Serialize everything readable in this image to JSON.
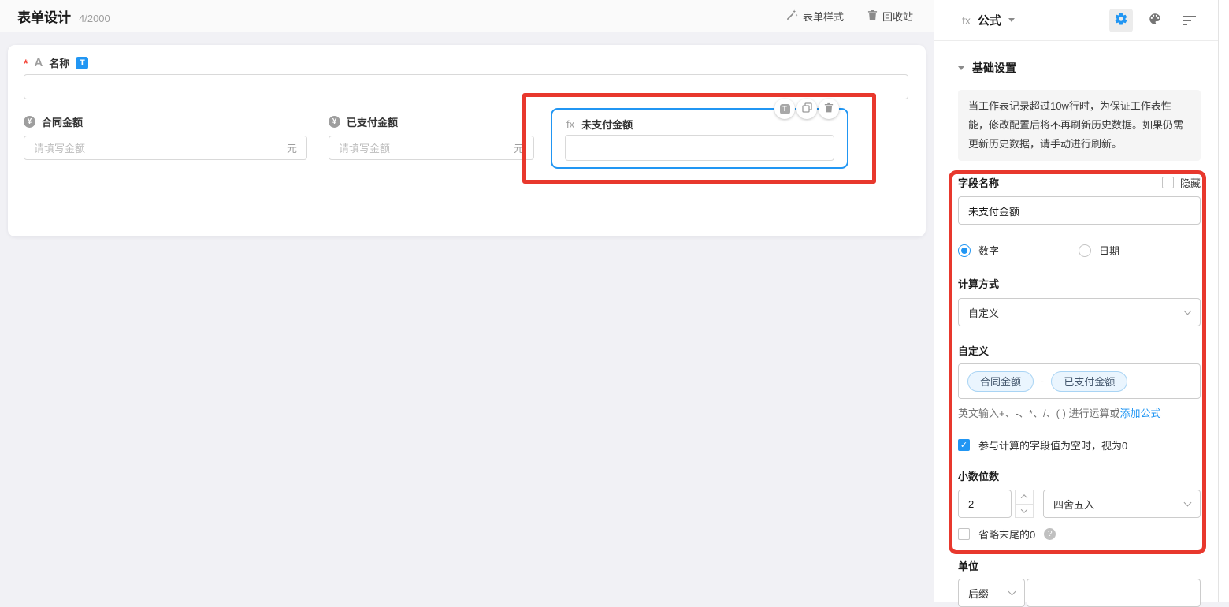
{
  "topbar": {
    "title": "表单设计",
    "count": "4/2000",
    "style_button": "表单样式",
    "recycle_button": "回收站"
  },
  "icons": {
    "asterisk": "*",
    "text_type": "A",
    "title_badge": "T",
    "currency": "¥",
    "fx": "fx",
    "check": "✓",
    "question": "?",
    "action_title": "T"
  },
  "canvas": {
    "name_field": {
      "label": "名称"
    },
    "amount_fields": [
      {
        "label": "合同金额",
        "placeholder": "请填写金额",
        "suffix": "元"
      },
      {
        "label": "已支付金额",
        "placeholder": "请填写金额",
        "suffix": "元"
      }
    ],
    "formula_field": {
      "label": "未支付金额"
    }
  },
  "panel": {
    "header_title": "公式",
    "section_title": "基础设置",
    "notice": "当工作表记录超过10w行时，为保证工作表性能，修改配置后将不再刷新历史数据。如果仍需更新历史数据，请手动进行刷新。",
    "field_name_label": "字段名称",
    "hide_label": "隐藏",
    "field_name_value": "未支付金额",
    "type_options": {
      "number": "数字",
      "date": "日期"
    },
    "calc_method_label": "计算方式",
    "calc_method_value": "自定义",
    "custom_label": "自定义",
    "formula": {
      "chip1": "合同金额",
      "operator": "-",
      "chip2": "已支付金额"
    },
    "hint_text": "英文输入+、-、*、/、( ) 进行运算或",
    "hint_link": "添加公式",
    "empty_as_zero_label": "参与计算的字段值为空时，视为0",
    "decimal_label": "小数位数",
    "decimal_value": "2",
    "rounding_value": "四舍五入",
    "omit_trailing_zero_label": "省略末尾的0",
    "unit_label": "单位",
    "unit_position_value": "后缀"
  },
  "colors": {
    "accent": "#2196f3",
    "annotation": "#e8382d"
  }
}
